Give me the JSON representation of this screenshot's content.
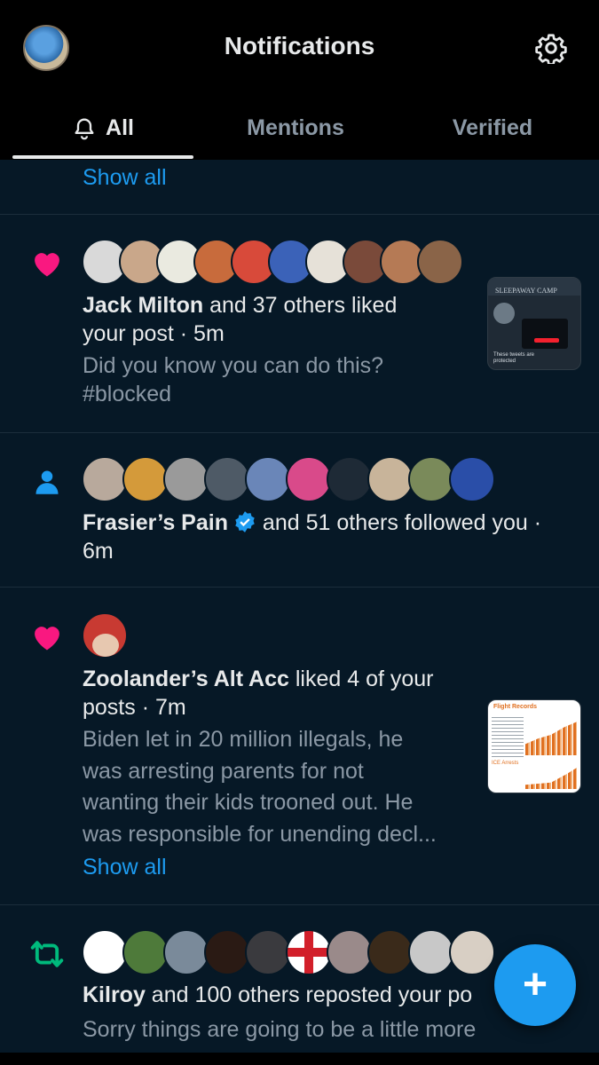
{
  "header": {
    "title": "Notifications"
  },
  "tabs": [
    {
      "label": "All",
      "active": true,
      "icon": "bell-icon"
    },
    {
      "label": "Mentions",
      "active": false
    },
    {
      "label": "Verified",
      "active": false
    }
  ],
  "top_show_all": "Show all",
  "notifications": [
    {
      "icon": "heart-icon",
      "actor": "Jack Milton",
      "action": " and 37 others liked",
      "action_line2": "your post · 5m",
      "preview_line1": "Did you know you can do this?",
      "preview_line2": "#blocked",
      "thumbnail": {
        "title": "SLEEPAWAY CAMP",
        "caption": "These tweets are protected"
      }
    },
    {
      "icon": "person-icon",
      "actor": "Frasier’s Pain",
      "verified": true,
      "action": " and 51 others followed you ·",
      "action_line2": "6m"
    },
    {
      "icon": "heart-icon",
      "actor": "Zoolander’s Alt Acc",
      "action": " liked 4 of your",
      "action_line2": "posts · 7m",
      "preview_lines": [
        "Biden let in 20 million illegals, he",
        "was arresting parents for not",
        "wanting their kids trooned out.  He",
        "was responsible for unending decl..."
      ],
      "show_all": "Show all",
      "thumbnail": {
        "title": "Flight Records",
        "subtitle": "ICE Arrests"
      }
    },
    {
      "icon": "repost-icon",
      "actor": "Kilroy",
      "action": " and 100 others reposted your po",
      "preview_line1": "Sorry things are going to be a little more"
    }
  ],
  "fab": {
    "label": "+"
  },
  "colors": {
    "background": "#061826",
    "accent": "#1d9bf0",
    "heart": "#f91880",
    "repost": "#00ba7c"
  }
}
